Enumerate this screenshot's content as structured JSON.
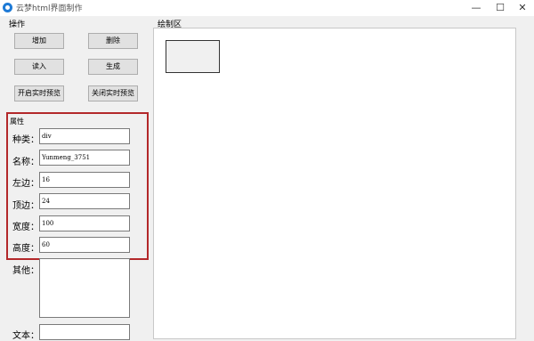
{
  "window": {
    "title": "云梦html界面制作",
    "minimize": "—",
    "maximize": "☐",
    "close": "✕"
  },
  "ops": {
    "label": "操作",
    "buttons": [
      "增加",
      "删除",
      "读入",
      "生成",
      "开启实时预览",
      "关闭实时预览"
    ]
  },
  "props": {
    "title": "属性",
    "rows": [
      {
        "label": "种类：",
        "value": "div"
      },
      {
        "label": "名称：",
        "value": "Yunmeng_3751"
      },
      {
        "label": "左边：",
        "value": "16"
      },
      {
        "label": "顶边：",
        "value": "24"
      },
      {
        "label": "宽度：",
        "value": "100"
      },
      {
        "label": "高度：",
        "value": "60"
      }
    ],
    "other_label": "其他：",
    "text_label": "文本："
  },
  "canvas": {
    "label": "绘制区"
  },
  "colors": {
    "highlight": "#b3282a",
    "app_icon": "#1e7ad6"
  }
}
